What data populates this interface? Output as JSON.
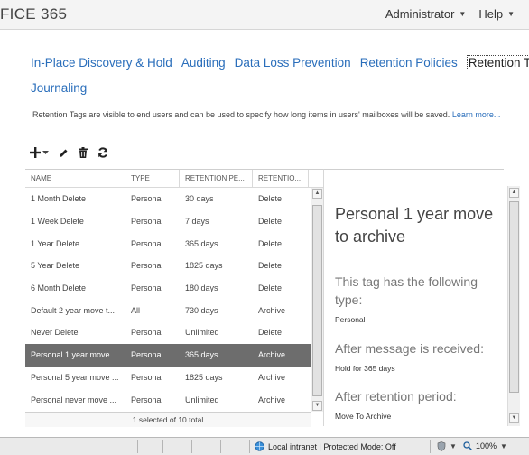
{
  "header": {
    "brand": "FICE 365",
    "admin_label": "Administrator",
    "help_label": "Help"
  },
  "nav": {
    "tabs": [
      {
        "label": "In-Place Discovery & Hold"
      },
      {
        "label": "Auditing"
      },
      {
        "label": "Data Loss Prevention"
      },
      {
        "label": "Retention Policies"
      },
      {
        "label": "Retention Tags"
      }
    ],
    "active": "Retention Tags",
    "second_row": "Journaling"
  },
  "description": {
    "text": "Retention Tags are visible to end users and can be used to specify how long items in users' mailboxes will be saved.",
    "link": "Learn more..."
  },
  "toolbar": {
    "icons": [
      "plus-icon",
      "chevron-down-icon",
      "pencil-icon",
      "trash-icon",
      "refresh-icon"
    ]
  },
  "table": {
    "columns": [
      "NAME",
      "TYPE",
      "RETENTION PE...",
      "RETENTIO..."
    ],
    "rows": [
      {
        "name": "1 Month Delete",
        "type": "Personal",
        "period": "30 days",
        "action": "Delete"
      },
      {
        "name": "1 Week Delete",
        "type": "Personal",
        "period": "7 days",
        "action": "Delete"
      },
      {
        "name": "1 Year Delete",
        "type": "Personal",
        "period": "365 days",
        "action": "Delete"
      },
      {
        "name": "5 Year Delete",
        "type": "Personal",
        "period": "1825 days",
        "action": "Delete"
      },
      {
        "name": "6 Month Delete",
        "type": "Personal",
        "period": "180 days",
        "action": "Delete"
      },
      {
        "name": "Default 2 year move t...",
        "type": "All",
        "period": "730 days",
        "action": "Archive"
      },
      {
        "name": "Never Delete",
        "type": "Personal",
        "period": "Unlimited",
        "action": "Delete"
      },
      {
        "name": "Personal 1 year move ...",
        "type": "Personal",
        "period": "365 days",
        "action": "Archive"
      },
      {
        "name": "Personal 5 year move ...",
        "type": "Personal",
        "period": "1825 days",
        "action": "Archive"
      },
      {
        "name": "Personal never move ...",
        "type": "Personal",
        "period": "Unlimited",
        "action": "Archive"
      }
    ],
    "selected_index": 7,
    "footer": "1 selected of 10 total"
  },
  "detail": {
    "title": "Personal 1 year move to archive",
    "type_label": "This tag has the following type:",
    "type_value": "Personal",
    "received_label": "After message is received:",
    "received_value": "Hold for 365 days",
    "period_label": "After retention period:",
    "period_value": "Move To Archive"
  },
  "statusbar": {
    "zone": "Local intranet | Protected Mode: Off",
    "zoom": "100%"
  },
  "colors": {
    "link": "#2a6ebb",
    "selected_row": "#6d6d6d"
  }
}
